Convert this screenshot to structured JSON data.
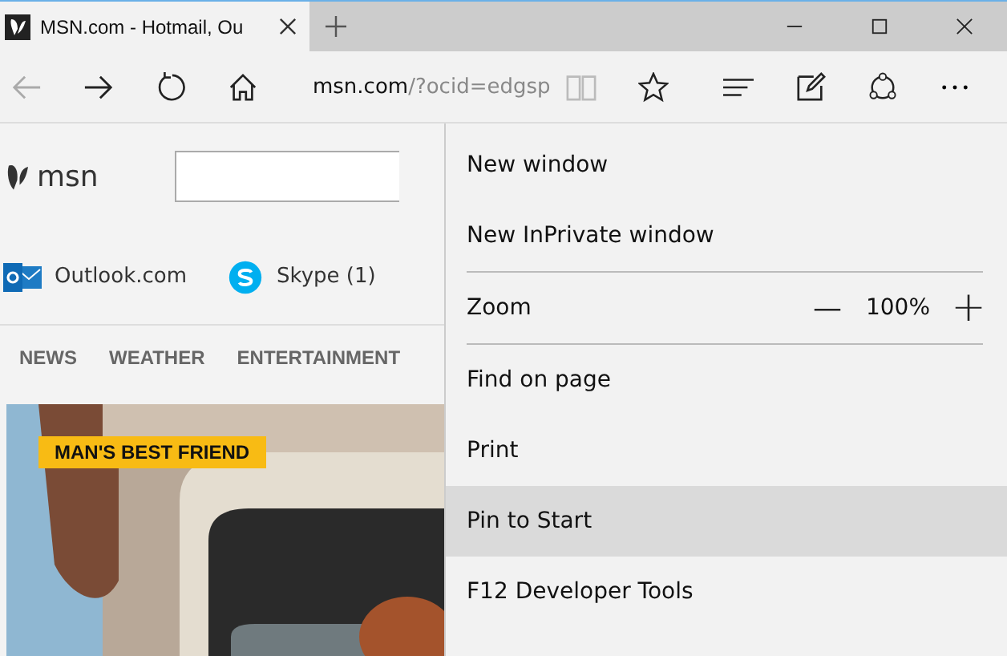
{
  "tab": {
    "title": "MSN.com - Hotmail, Ou"
  },
  "address": {
    "host": "msn.com",
    "path": "/?ocid=edgsp"
  },
  "page": {
    "logo": "msn",
    "links": [
      {
        "kind": "outlook",
        "label": "Outlook.com"
      },
      {
        "kind": "skype",
        "label": "Skype (1)"
      }
    ],
    "nav": [
      "NEWS",
      "WEATHER",
      "ENTERTAINMENT"
    ],
    "hero": {
      "kind": "picture",
      "tag": "MAN'S BEST FRIEND"
    }
  },
  "menu": {
    "items": [
      {
        "kind": "item",
        "label": "New window",
        "selected": false
      },
      {
        "kind": "item",
        "label": "New InPrivate window",
        "selected": false
      },
      {
        "kind": "divider"
      },
      {
        "kind": "zoom",
        "label": "Zoom",
        "minus": "—",
        "value": "100%",
        "plus": "+"
      },
      {
        "kind": "divider"
      },
      {
        "kind": "item",
        "label": "Find on page",
        "selected": false
      },
      {
        "kind": "item",
        "label": "Print",
        "selected": false
      },
      {
        "kind": "item",
        "label": "Pin to Start",
        "selected": true
      },
      {
        "kind": "item",
        "label": "F12 Developer Tools",
        "selected": false
      }
    ]
  }
}
